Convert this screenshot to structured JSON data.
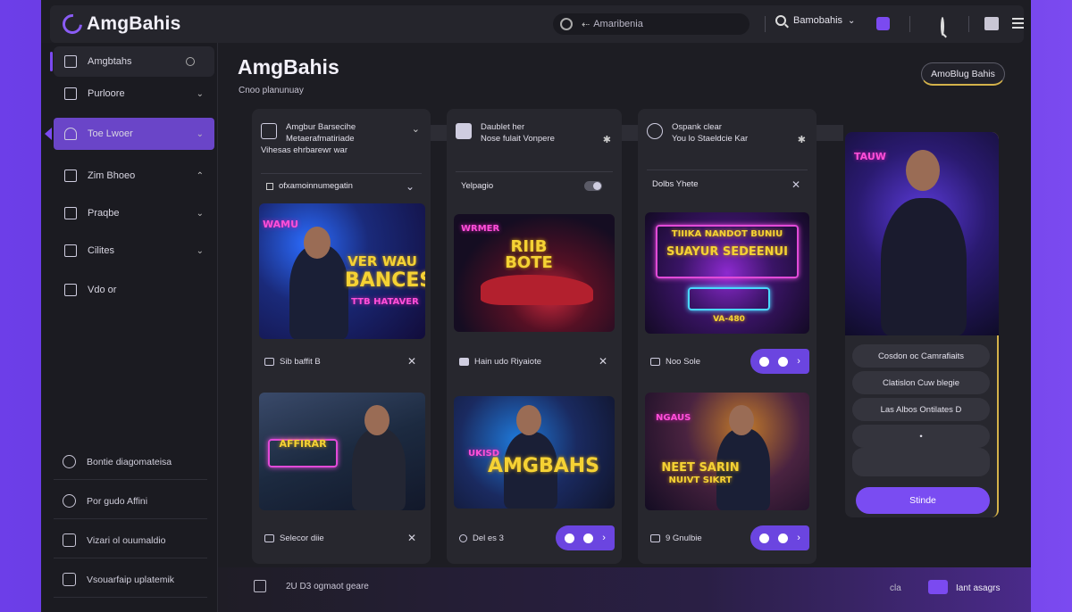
{
  "app": {
    "title": "AmgBahis"
  },
  "topbar": {
    "search_text": "Amaribenia",
    "account_label": "Bamobahis"
  },
  "sidebar": {
    "items": [
      {
        "label": "Amgbtahs"
      },
      {
        "label": "Purloore"
      },
      {
        "label": "Toe Lwoer"
      },
      {
        "label": "Zim Bhoeo"
      },
      {
        "label": "Praqbe"
      },
      {
        "label": "Cilites"
      },
      {
        "label": "Vdo or"
      }
    ],
    "bottom_items": [
      {
        "label": "Bontie diagomateisa"
      },
      {
        "label": "Por gudo Affini"
      },
      {
        "label": "Vizari ol ouumaldio"
      },
      {
        "label": "Vsouarfaip uplatemik"
      }
    ]
  },
  "main": {
    "title": "AmgBahis",
    "subtitle": "Cnoo planunuay",
    "top_button": "AmoBlug Bahis"
  },
  "columns": [
    {
      "header_lines": [
        "Amgbur Barsecihe",
        "Metaerafmatiriade",
        "Vihesas ehrbarewr war"
      ],
      "field": "ofxamoinnumegatin",
      "cards": [
        {
          "neon_top": "WAMU",
          "neon_main": "BANCES",
          "neon_sub": "TTB HATAVER",
          "neon_overlay": "VER WAU",
          "footer": "Sib baffit B"
        },
        {
          "neon_top": "AFFIRAR",
          "neon_main": "",
          "neon_sub": "",
          "neon_overlay": "",
          "footer": "Selecor diie"
        }
      ]
    },
    {
      "header_lines": [
        "Daublet her",
        "Nose fulait Vonpere"
      ],
      "field": "Yelpagio",
      "cards": [
        {
          "neon_top": "WRMER",
          "neon_main": "RIIB BOTE",
          "neon_sub": "",
          "neon_overlay": "",
          "footer": "Hain udo Riyaiote"
        },
        {
          "neon_top": "",
          "neon_main": "AMGBAHS",
          "neon_sub": "",
          "neon_overlay": "UKISD",
          "footer": "Del es 3"
        }
      ]
    },
    {
      "header_lines": [
        "Ospank clear",
        "You lo Staeldcie Kar"
      ],
      "field": "Dolbs Yhete",
      "cards": [
        {
          "neon_top": "TIIIKA NANDOT BUNIU",
          "neon_main": "SUAYUR SEDEENUI",
          "neon_sub": "VA-480",
          "neon_overlay": "",
          "footer": "Noo Sole"
        },
        {
          "neon_top": "NGAUS",
          "neon_main": "NEET SARIN",
          "neon_sub": "",
          "neon_overlay": "NUIVT SIKRT",
          "footer": "9 Gnulbie"
        }
      ]
    }
  ],
  "right_panel": {
    "neon_top": "TAUW",
    "buttons": [
      "Cosdon oc Camrafiaits",
      "Clatislon Cuw blegie",
      "Las Albos Ontilates D",
      "•",
      ""
    ],
    "submit": "Stinde"
  },
  "bottom": {
    "text": "2U D3 ogmaot geare",
    "right_small": "cla",
    "right_label": "Iant asagrs"
  }
}
